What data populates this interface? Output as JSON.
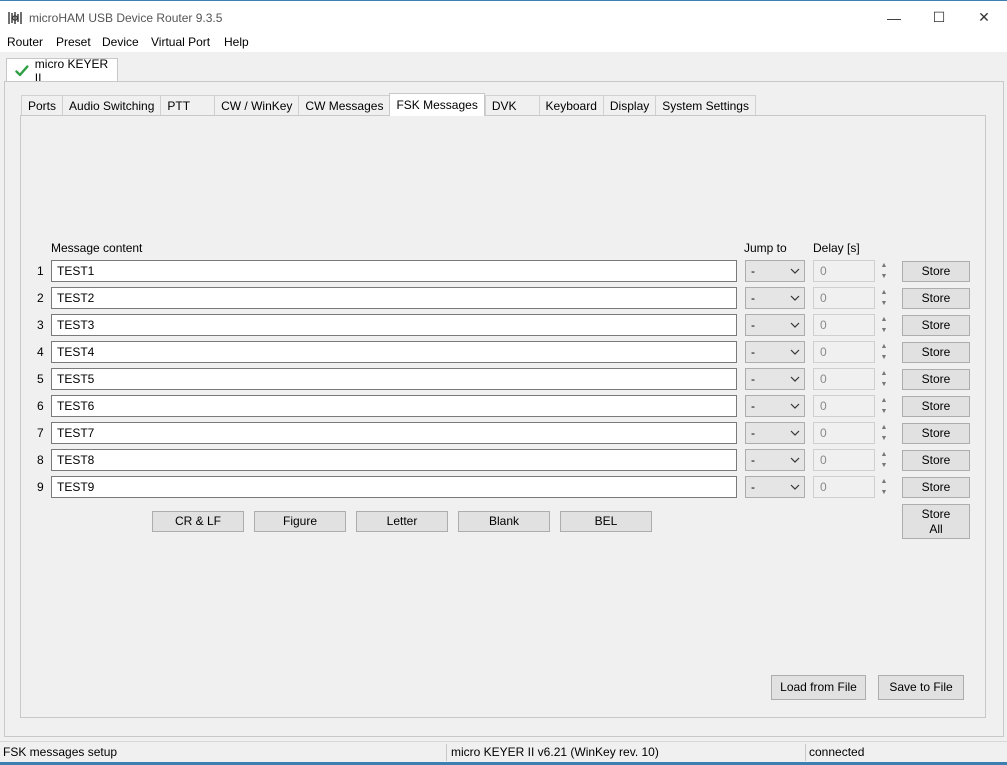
{
  "window": {
    "title": "microHAM USB Device Router 9.3.5",
    "minimize": "—",
    "maximize": "☐",
    "close": "✕"
  },
  "menu": [
    "Router",
    "Preset",
    "Device",
    "Virtual Port",
    "Help"
  ],
  "device_tab": {
    "label": "micro KEYER II",
    "icon": "green-check-icon"
  },
  "tabs": [
    "Ports",
    "Audio Switching",
    "PTT",
    "CW / WinKey",
    "CW Messages",
    "FSK Messages",
    "DVK",
    "Keyboard",
    "Display",
    "System Settings"
  ],
  "active_tab": "FSK Messages",
  "headers": {
    "content": "Message content",
    "jump": "Jump to",
    "delay": "Delay [s]"
  },
  "messages": [
    {
      "num": "1",
      "content": "TEST1",
      "jump": "-",
      "delay": "0",
      "store": "Store"
    },
    {
      "num": "2",
      "content": "TEST2",
      "jump": "-",
      "delay": "0",
      "store": "Store"
    },
    {
      "num": "3",
      "content": "TEST3",
      "jump": "-",
      "delay": "0",
      "store": "Store"
    },
    {
      "num": "4",
      "content": "TEST4",
      "jump": "-",
      "delay": "0",
      "store": "Store"
    },
    {
      "num": "5",
      "content": "TEST5",
      "jump": "-",
      "delay": "0",
      "store": "Store"
    },
    {
      "num": "6",
      "content": "TEST6",
      "jump": "-",
      "delay": "0",
      "store": "Store"
    },
    {
      "num": "7",
      "content": "TEST7",
      "jump": "-",
      "delay": "0",
      "store": "Store"
    },
    {
      "num": "8",
      "content": "TEST8",
      "jump": "-",
      "delay": "0",
      "store": "Store"
    },
    {
      "num": "9",
      "content": "TEST9",
      "jump": "-",
      "delay": "0",
      "store": "Store"
    }
  ],
  "symbol_buttons": [
    "CR & LF",
    "Figure",
    "Letter",
    "Blank",
    "BEL"
  ],
  "store_all": {
    "line1": "Store",
    "line2": "All"
  },
  "file_buttons": {
    "load": "Load from File",
    "save": "Save to File"
  },
  "status": {
    "left": "FSK messages setup",
    "middle": "micro KEYER II v6.21 (WinKey rev. 10)",
    "right": "connected"
  },
  "colors": {
    "accent": "#3c7fb1",
    "check": "#2ea043"
  }
}
